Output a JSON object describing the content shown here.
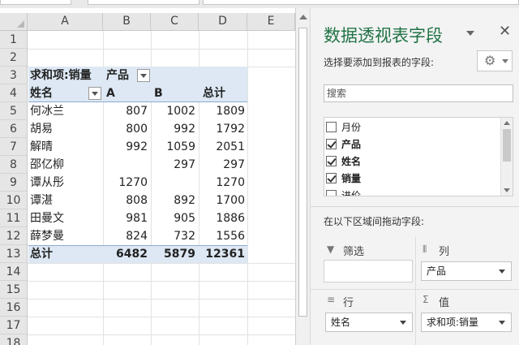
{
  "sheet": {
    "columns": [
      "A",
      "B",
      "C",
      "D",
      "E"
    ],
    "rows": [
      "1",
      "2",
      "3",
      "4",
      "5",
      "6",
      "7",
      "8",
      "9",
      "10",
      "11",
      "12",
      "13",
      "14",
      "15",
      "16",
      "17",
      "18"
    ]
  },
  "pivot": {
    "value_label": "求和项:销量",
    "col_field": "产品",
    "row_field": "姓名",
    "col_items": [
      "A",
      "B",
      "总计"
    ],
    "rows": [
      {
        "name": "何冰兰",
        "a": "807",
        "b": "1002",
        "total": "1809"
      },
      {
        "name": "胡易",
        "a": "800",
        "b": "992",
        "total": "1792"
      },
      {
        "name": "解晴",
        "a": "992",
        "b": "1059",
        "total": "2051"
      },
      {
        "name": "邵亿柳",
        "a": "",
        "b": "297",
        "total": "297"
      },
      {
        "name": "谭从彤",
        "a": "1270",
        "b": "",
        "total": "1270"
      },
      {
        "name": "谭湛",
        "a": "808",
        "b": "892",
        "total": "1700"
      },
      {
        "name": "田曼文",
        "a": "981",
        "b": "905",
        "total": "1886"
      },
      {
        "name": "薛梦曼",
        "a": "824",
        "b": "732",
        "total": "1556"
      }
    ],
    "grand_total": {
      "name": "总计",
      "a": "6482",
      "b": "5879",
      "total": "12361"
    }
  },
  "pane": {
    "title": "数据透视表字段",
    "close": "✕",
    "choose_label": "选择要添加到报表的字段:",
    "search_placeholder": "搜索",
    "fields": [
      {
        "label": "月份",
        "checked": false
      },
      {
        "label": "产品",
        "checked": true
      },
      {
        "label": "姓名",
        "checked": true
      },
      {
        "label": "销量",
        "checked": true
      },
      {
        "label": "进价",
        "checked": false
      }
    ],
    "drag_label": "在以下区域间拖动字段:",
    "areas": {
      "filter": {
        "title": "筛选",
        "icon": "▼"
      },
      "columns": {
        "title": "列",
        "icon": "⦀",
        "chip": "产品"
      },
      "rows": {
        "title": "行",
        "icon": "≡",
        "chip": "姓名"
      },
      "values": {
        "title": "值",
        "icon": "Σ",
        "chip": "求和项:销量"
      }
    }
  },
  "colors": {
    "accent": "#217346",
    "pivot_band": "#dde8f4"
  }
}
